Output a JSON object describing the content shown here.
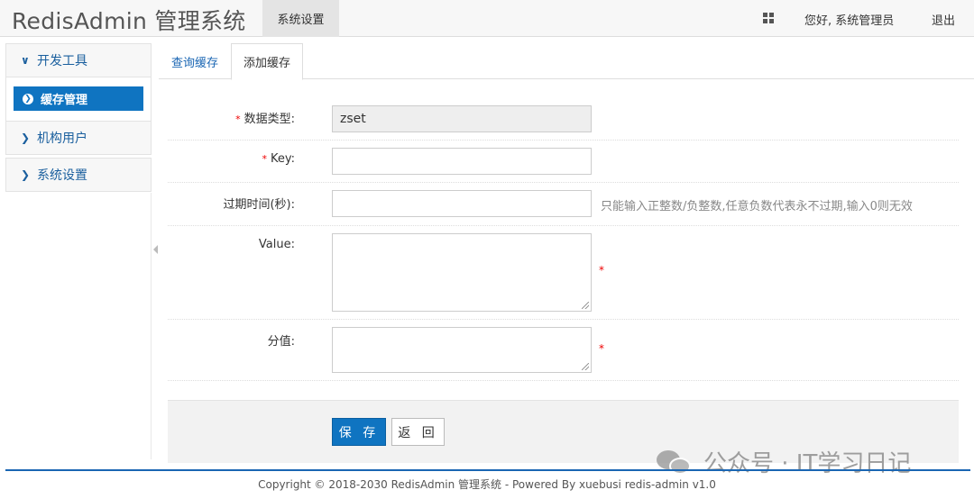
{
  "header": {
    "brand": "RedisAdmin 管理系统",
    "nav_active": "系统设置",
    "grid_icon": "apps-grid-icon",
    "greeting": "您好, 系统管理员",
    "logout": "退出"
  },
  "sidebar": {
    "groups": [
      {
        "label": "开发工具",
        "expanded": true,
        "icon": "chevron-down-icon"
      },
      {
        "label": "机构用户",
        "expanded": false,
        "icon": "chevron-right-icon"
      },
      {
        "label": "系统设置",
        "expanded": false,
        "icon": "chevron-right-icon"
      }
    ],
    "active_item": {
      "label": "缓存管理",
      "icon": "arrow-circle-right-icon"
    }
  },
  "tabs": [
    {
      "label": "查询缓存",
      "active": false
    },
    {
      "label": "添加缓存",
      "active": true
    }
  ],
  "form": {
    "data_type": {
      "label": "数据类型:",
      "required": true,
      "value": "zset"
    },
    "key": {
      "label": "Key:",
      "required": true,
      "value": ""
    },
    "expire": {
      "label": "过期时间(秒):",
      "required": false,
      "value": "",
      "hint": "只能输入正整数/负整数,任意负数代表永不过期,输入0则无效"
    },
    "value": {
      "label": "Value:",
      "required_mark": "*"
    },
    "score": {
      "label": "分值:",
      "required_mark": "*"
    },
    "required_mark": "*"
  },
  "actions": {
    "save": "保 存",
    "back": "返 回"
  },
  "watermark": "公众号 · IT学习日记",
  "footer": "Copyright © 2018-2030 RedisAdmin 管理系统 - Powered By xuebusi redis-admin v1.0",
  "colors": {
    "primary": "#0f74c1",
    "link": "#1a66b3",
    "required": "#ee0000"
  }
}
